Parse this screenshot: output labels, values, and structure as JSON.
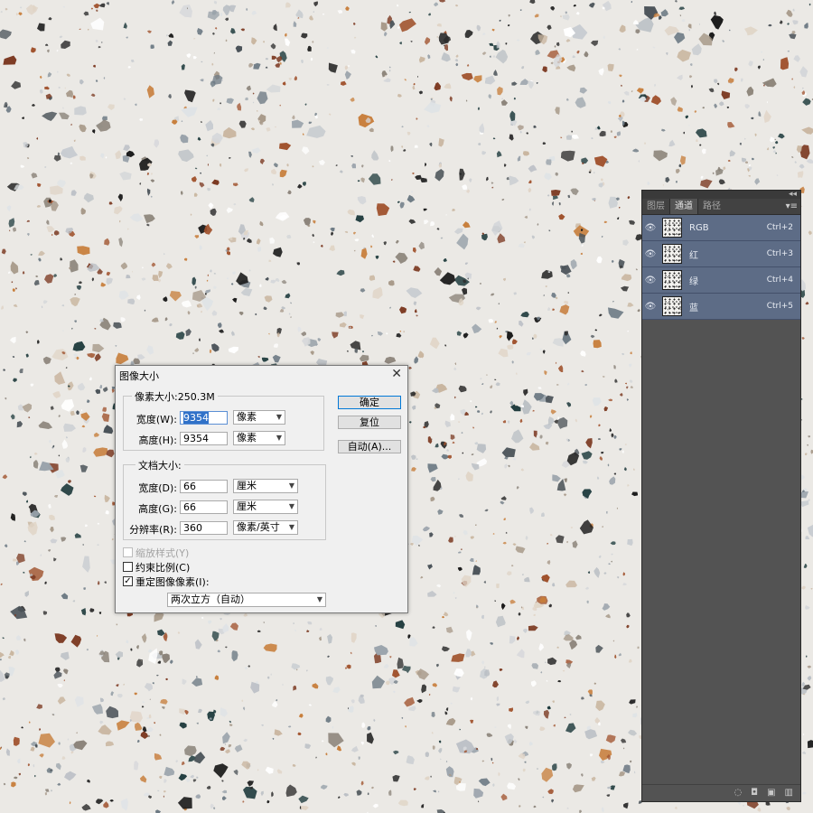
{
  "channels_panel": {
    "collapse_glyph": "◂◂",
    "menu_glyph": "▾≡",
    "tabs": [
      {
        "label": "图层",
        "active": false
      },
      {
        "label": "通道",
        "active": true
      },
      {
        "label": "路径",
        "active": false
      }
    ],
    "channels": [
      {
        "name": "RGB",
        "shortcut": "Ctrl+2"
      },
      {
        "name": "红",
        "shortcut": "Ctrl+3"
      },
      {
        "name": "绿",
        "shortcut": "Ctrl+4"
      },
      {
        "name": "蓝",
        "shortcut": "Ctrl+5"
      }
    ],
    "footer_icons": [
      "load-selection-icon",
      "save-selection-icon",
      "new-channel-icon",
      "delete-channel-icon"
    ],
    "selected_color": "#5d6c86"
  },
  "image_size_dialog": {
    "title": "图像大小",
    "close_glyph": "✕",
    "pixel_dimensions": {
      "label": "像素大小:250.3M",
      "width_label": "宽度(W):",
      "width_value": "9354",
      "width_unit": "像素",
      "height_label": "高度(H):",
      "height_value": "9354",
      "height_unit": "像素"
    },
    "document_size": {
      "label": "文档大小:",
      "width_label": "宽度(D):",
      "width_value": "66",
      "width_unit": "厘米",
      "height_label": "高度(G):",
      "height_value": "66",
      "height_unit": "厘米",
      "resolution_label": "分辨率(R):",
      "resolution_value": "360",
      "resolution_unit": "像素/英寸"
    },
    "options": {
      "scale_styles": {
        "label": "缩放样式(Y)",
        "checked": false,
        "disabled": true
      },
      "constrain": {
        "label": "约束比例(C)",
        "checked": false
      },
      "resample": {
        "label": "重定图像像素(I):",
        "checked": true
      },
      "resample_method": "两次立方（自动）"
    },
    "buttons": {
      "ok": "确定",
      "reset": "复位",
      "auto": "自动(A)..."
    }
  }
}
